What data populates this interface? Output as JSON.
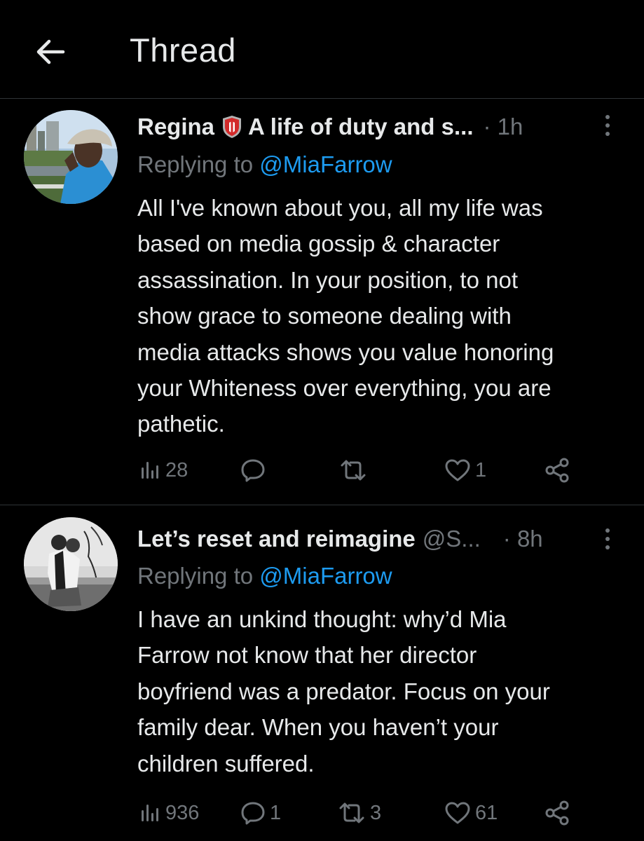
{
  "header": {
    "title": "Thread"
  },
  "tweets": [
    {
      "display_name": "Regina",
      "handle_text": "A life of duty and s...",
      "time": "· 1h",
      "replying_label": "Replying to ",
      "replying_to": "@MiaFarrow",
      "body_lines": [
        "All I've known about you, all my life was",
        "based on media gossip & character",
        "assassination. In your position, to not",
        "show grace to someone dealing with",
        "media attacks shows you value honoring",
        "your Whiteness over everything, you are",
        "pathetic."
      ],
      "views": "28",
      "replies": "",
      "retweets": "",
      "likes": "1"
    },
    {
      "display_name": "Let’s reset and reimagine",
      "handle_text": "@S...",
      "time": "· 8h",
      "replying_label": "Replying to ",
      "replying_to": "@MiaFarrow",
      "body_lines": [
        "I have an unkind thought: why’d Mia",
        "Farrow not know that her director",
        "boyfriend was a predator. Focus on your",
        "family dear. When you haven’t your",
        "children suffered."
      ],
      "views": "936",
      "replies": "1",
      "retweets": "3",
      "likes": "61"
    }
  ],
  "colors": {
    "background": "#000000",
    "text": "#e7e9ea",
    "secondary": "#71767b",
    "link": "#1d9bf0",
    "divider": "#2f3336"
  }
}
